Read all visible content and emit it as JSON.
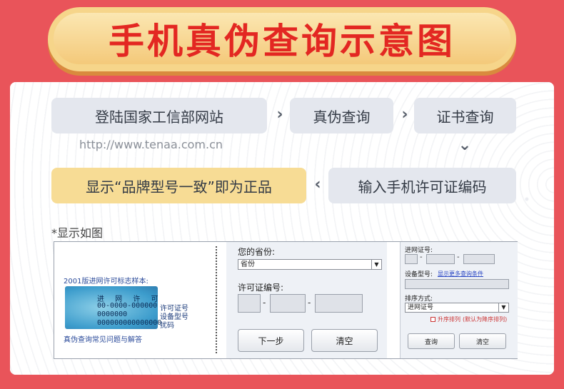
{
  "title": "手机真伪查询示意图",
  "steps": {
    "step1": "登陆国家工信部网站",
    "step2": "真伪查询",
    "step3": "证书查询",
    "step4": "输入手机许可证编码",
    "step5": "显示“品牌型号一致”即为正品"
  },
  "arrows": {
    "right": "›",
    "down": "⌄",
    "left": "‹"
  },
  "url": "http://www.tenaa.com.cn",
  "note": "*显示如图",
  "license": {
    "title": "2001版进网许可标志样本:",
    "head": "进 网 许 可",
    "num1": "00-0000-000000",
    "num2": "0000000",
    "num3": "000000000000000",
    "label1": "许可证号",
    "label2": "设备型号",
    "label3": "扰码",
    "footer": "真伪查询常见问题与解答"
  },
  "form_mid": {
    "province_label": "您的省份:",
    "province_value": "省份",
    "license_label": "许可证编号:",
    "next_button": "下一步",
    "clear_button": "清空"
  },
  "form_right": {
    "net_label": "进网证号:",
    "model_label": "设备型号:",
    "model_link": "显示更多查询条件",
    "sort_label": "排序方式:",
    "sort_value": "进网证号",
    "asc_label": "升序排列",
    "asc_hint": "(默认为降序排列)",
    "query_button": "查询",
    "clear_button": "清空"
  }
}
